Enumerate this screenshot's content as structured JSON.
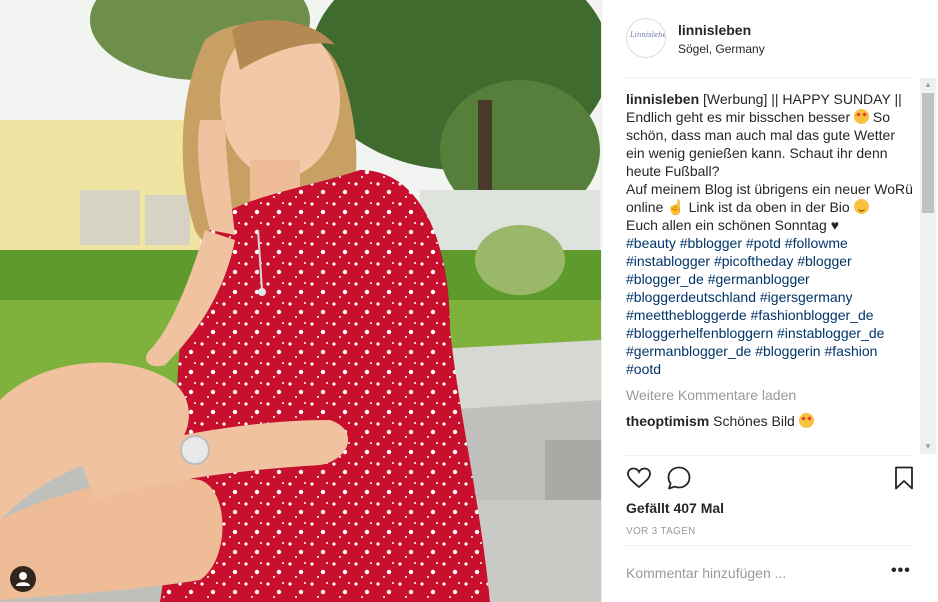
{
  "post": {
    "username": "linnisleben",
    "location": "Sögel, Germany",
    "avatar_logo": "Linnisleben",
    "caption_user": "linnisleben",
    "caption_lines": [
      "[Werbung] || HAPPY SUNDAY || Endlich geht es mir bisschen besser",
      "So schön, dass man auch mal das gute Wetter ein wenig genießen kann. Schaut ihr denn heute Fußball?",
      "Auf meinem Blog ist übrigens ein neuer WoRü online",
      "Link ist da oben in der Bio",
      "Euch allen ein schönen Sonntag ♥"
    ],
    "hashtags": "#beauty #bblogger #potd #followme #instablogger #picoftheday #blogger #blogger_de #germanblogger #bloggerdeutschland #igersgermany #meetthebloggerde #fashionblogger_de #bloggerhelfenbloggern #instablogger_de #germanblogger_de #bloggerin #fashion #ootd",
    "load_more": "Weitere Kommentare laden",
    "comment_user": "theoptimism",
    "comment_text": "Schönes Bild",
    "likes": "Gefällt 407 Mal",
    "time": "VOR 3 TAGEN",
    "add_comment_placeholder": "Kommentar hinzufügen ...",
    "more_options": "•••"
  },
  "icons": [
    "heart-icon",
    "comment-icon",
    "bookmark-icon",
    "user-tag-icon"
  ],
  "colors": {
    "hashtag": "#003569",
    "muted": "#999999",
    "dress_red": "#c8102e"
  }
}
